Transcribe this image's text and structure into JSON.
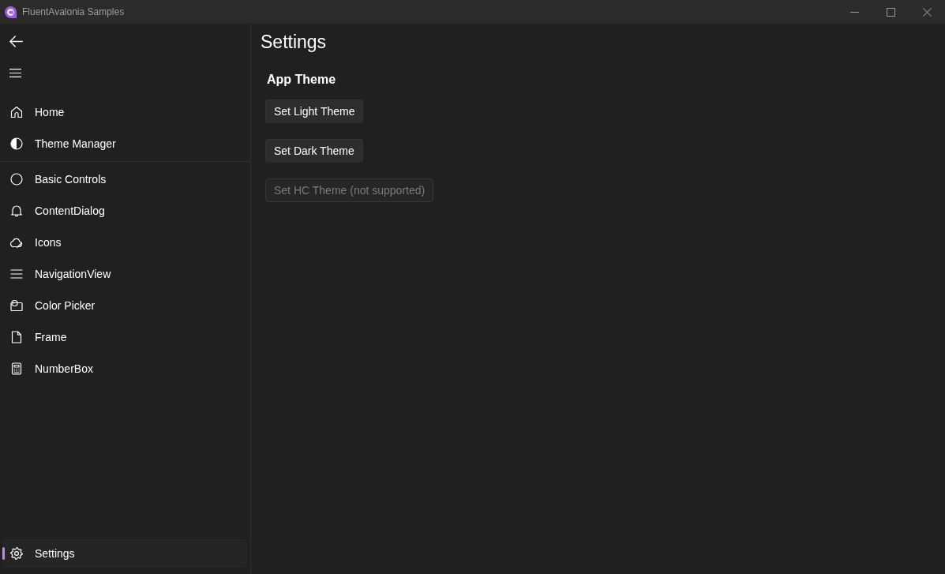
{
  "window": {
    "title": "FluentAvalonia Samples"
  },
  "nav": {
    "header_items": [
      {
        "label": "Home",
        "selected": false
      },
      {
        "label": "Theme Manager",
        "selected": false
      }
    ],
    "items": [
      {
        "label": "Basic Controls",
        "selected": false
      },
      {
        "label": "ContentDialog",
        "selected": false
      },
      {
        "label": "Icons",
        "selected": false
      },
      {
        "label": "NavigationView",
        "selected": false
      },
      {
        "label": "Color Picker",
        "selected": false
      },
      {
        "label": "Frame",
        "selected": false
      },
      {
        "label": "NumberBox",
        "selected": false
      }
    ],
    "footer_items": [
      {
        "label": "Settings",
        "selected": true
      }
    ]
  },
  "page": {
    "title": "Settings",
    "sections": [
      {
        "heading": "App Theme",
        "buttons": [
          {
            "label": "Set Light Theme",
            "disabled": false
          },
          {
            "label": "Set Dark Theme",
            "disabled": false
          },
          {
            "label": "Set HC Theme (not supported)",
            "disabled": true
          }
        ]
      }
    ]
  }
}
